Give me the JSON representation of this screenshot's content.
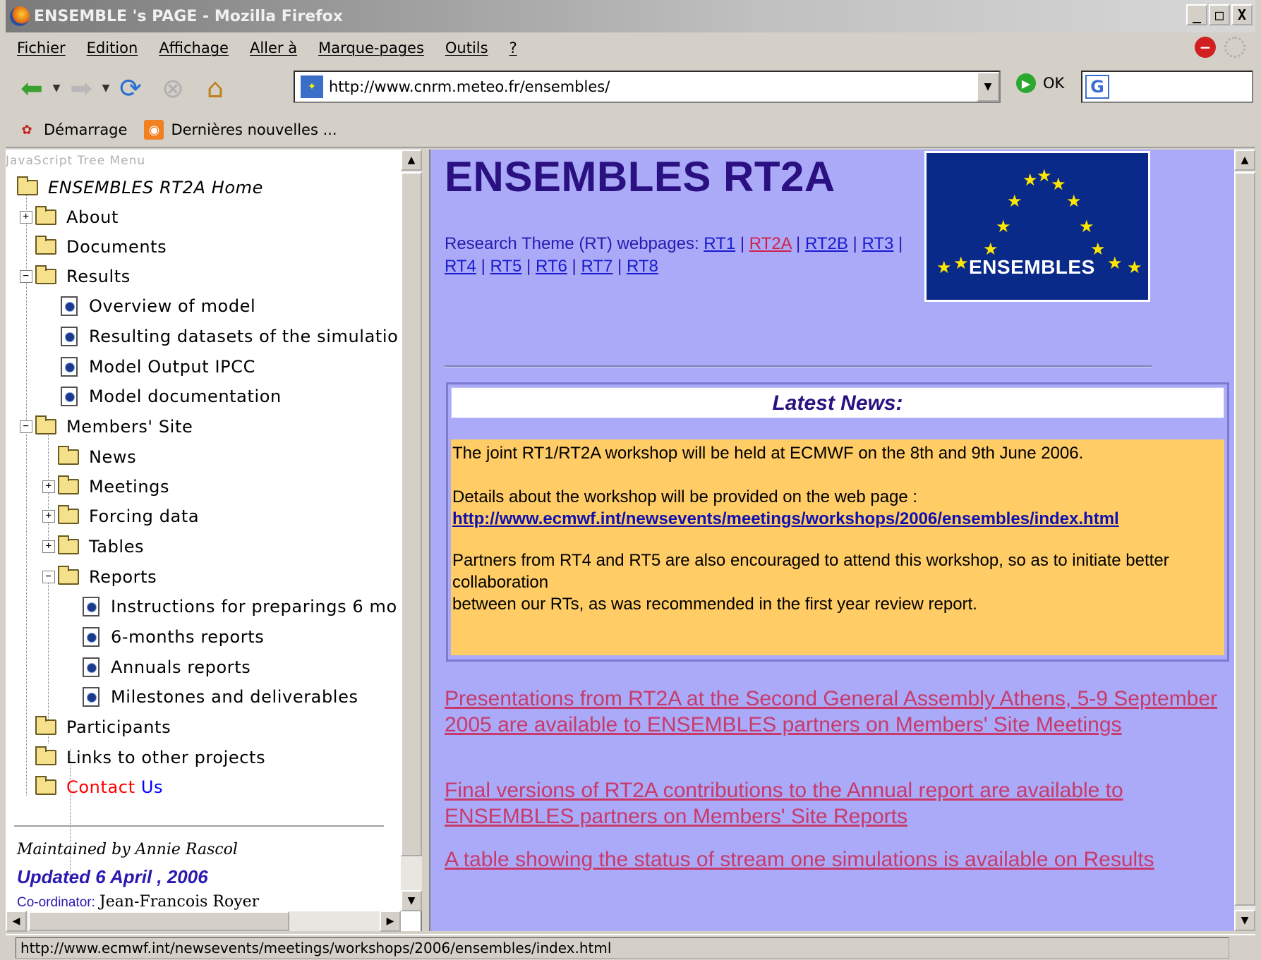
{
  "window": {
    "title": "ENSEMBLE 's PAGE - Mozilla Firefox",
    "buttons": [
      "_",
      "□",
      "X"
    ]
  },
  "menubar": {
    "items": [
      "Fichier",
      "Edition",
      "Affichage",
      "Aller à",
      "Marque-pages",
      "Outils",
      "?"
    ]
  },
  "navbar": {
    "url": "http://www.cnrm.meteo.fr/ensembles/",
    "go_label": "OK",
    "search_engine": "G"
  },
  "bookmarks": {
    "items": [
      "Démarrage",
      "Dernières nouvelles ..."
    ]
  },
  "tree": {
    "caption": "JavaScript Tree Menu",
    "home": "ENSEMBLES RT2A Home",
    "items": [
      "About",
      "Documents",
      "Results",
      "Overview of model",
      "Resulting datasets of the simulatio",
      "Model Output IPCC",
      "Model documentation",
      "Members' Site",
      "News",
      "Meetings",
      "Forcing data",
      "Tables",
      "Reports",
      "Instructions for preparings 6 mo",
      "6-months reports",
      "Annuals reports",
      "Milestones and deliverables",
      "Participants",
      "Links to other projects"
    ],
    "contact": {
      "part1": "Contact",
      "part2": "Us"
    }
  },
  "left_footer": {
    "maintained": "Maintained by Annie Rascol",
    "updated": "Updated 6 April , 2006",
    "coordinator_label": "Co-ordinator:",
    "coordinator_name": "Jean-Francois Royer"
  },
  "main": {
    "title": "ENSEMBLES RT2A",
    "rt_prefix": "Research Theme (RT) webpages:",
    "rt_links": [
      "RT1",
      "RT2A",
      "RT2B",
      "RT3",
      "RT4",
      "RT5",
      "RT6",
      "RT7",
      "RT8"
    ],
    "logo_text": "ENSEMBLES",
    "news": {
      "heading": "Latest News:",
      "p1": "The joint RT1/RT2A workshop will be held at ECMWF on the 8th and 9th June 2006.",
      "p2": "Details about the workshop will be provided on the web page :",
      "p2_link": "http://www.ecmwf.int/newsevents/meetings/workshops/2006/ensembles/index.html",
      "p3a": "Partners from RT4 and RT5 are also encouraged to attend this workshop, so as to initiate better collaboration",
      "p3b": "between our RTs, as was recommended in the first year review report."
    },
    "link1": "Presentations from RT2A at the Second General Assembly Athens, 5-9 September 2005 are available to ENSEMBLES partners on Members' Site Meetings",
    "link2": "Final versions of RT2A contributions to the Annual report are available to ENSEMBLES partners on Members' Site Reports",
    "link3": "A table showing the status of stream one simulations is available on Results"
  },
  "status": {
    "text": "http://www.ecmwf.int/newsevents/meetings/workshops/2006/ensembles/index.html"
  }
}
